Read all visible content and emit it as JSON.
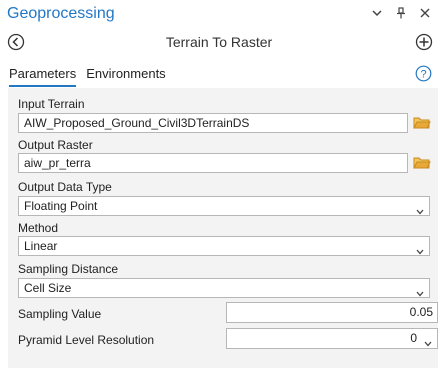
{
  "pane": {
    "title": "Geoprocessing"
  },
  "tool": {
    "title": "Terrain To Raster"
  },
  "tabs": [
    {
      "label": "Parameters",
      "active": true
    },
    {
      "label": "Environments",
      "active": false
    }
  ],
  "params": {
    "input_terrain": {
      "label": "Input Terrain",
      "value": "AIW_Proposed_Ground_Civil3DTerrainDS"
    },
    "output_raster": {
      "label": "Output Raster",
      "value": "aiw_pr_terra"
    },
    "output_data_type": {
      "label": "Output Data Type",
      "value": "Floating Point"
    },
    "method": {
      "label": "Method",
      "value": "Linear"
    },
    "sampling_distance": {
      "label": "Sampling Distance",
      "value": "Cell Size"
    },
    "sampling_value": {
      "label": "Sampling Value",
      "value": "0.05"
    },
    "pyramid_level": {
      "label": "Pyramid Level Resolution",
      "value": "0"
    }
  },
  "colors": {
    "accent": "#2377c4",
    "folder": "#e8a93a",
    "panel_bg": "#f3f3f3"
  },
  "icons": [
    "chevron-down-icon",
    "pin-icon",
    "close-icon",
    "back-icon",
    "add-icon",
    "help-icon",
    "folder-icon"
  ]
}
